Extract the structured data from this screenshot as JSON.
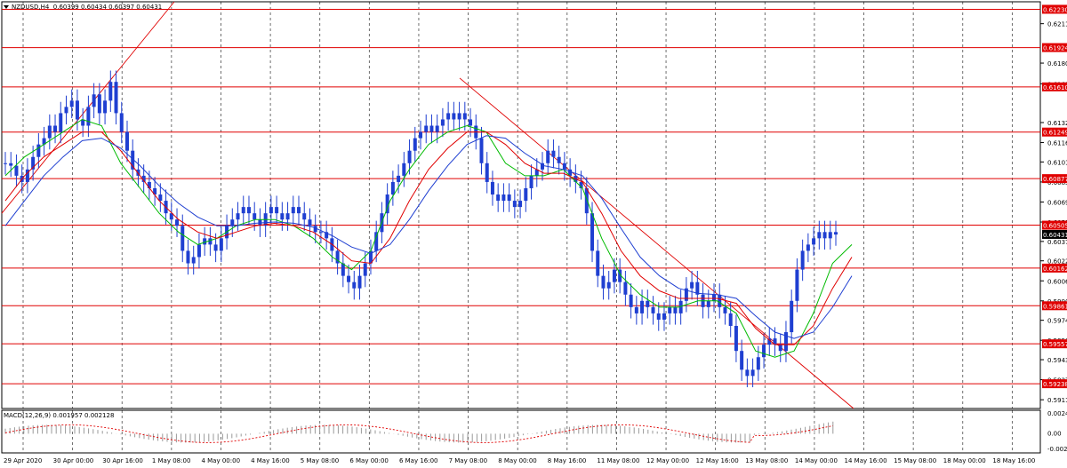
{
  "header": {
    "symbol": "NZDUSD,H4",
    "ohlc": "0.60399 0.60434 0.60397 0.60431"
  },
  "macd_header": {
    "label": "MACD(12,26,9) 0.001957 0.002128"
  },
  "colors": {
    "candles": "#1f3fd1",
    "levels": "#e00000",
    "ma_fast": "#00bb00",
    "ma_mid": "#e00000",
    "ma_slow": "#1f3fd1",
    "grid": "#000000",
    "background": "#ffffff"
  },
  "price_axis": {
    "ticks": [
      "0.62115",
      "0.61800",
      "0.61635",
      "0.61325",
      "0.61165",
      "0.61010",
      "0.60850",
      "0.60690",
      "0.60530",
      "0.60375",
      "0.60220",
      "0.60060",
      "0.59900",
      "0.59745",
      "0.59585",
      "0.59430",
      "0.59270",
      "0.59110"
    ],
    "current_price": "0.60431"
  },
  "levels": [
    "0.62230",
    "0.61924",
    "0.61610",
    "0.61249",
    "0.60877",
    "0.60505",
    "0.60162",
    "0.59861",
    "0.59557",
    "0.59238"
  ],
  "time_axis": [
    "29 Apr 2020",
    "30 Apr 00:00",
    "30 Apr 16:00",
    "1 May 08:00",
    "4 May 00:00",
    "4 May 16:00",
    "5 May 08:00",
    "6 May 00:00",
    "6 May 16:00",
    "7 May 08:00",
    "8 May 00:00",
    "8 May 16:00",
    "11 May 08:00",
    "12 May 00:00",
    "12 May 16:00",
    "13 May 08:00",
    "14 May 00:00",
    "14 May 16:00",
    "15 May 08:00",
    "18 May 00:00",
    "18 May 16:00"
  ],
  "macd_axis": [
    "0.002448",
    "0.00",
    "-0.00232"
  ],
  "chart_data": {
    "type": "line",
    "title": "NZDUSD,H4",
    "ylim": [
      0.5904,
      0.6229
    ],
    "grid": true,
    "series": [
      {
        "name": "NZDUSD,H4",
        "values": [
          0.61,
          0.6098,
          0.609,
          0.6085,
          0.6095,
          0.6105,
          0.6115,
          0.612,
          0.613,
          0.6125,
          0.614,
          0.6145,
          0.615,
          0.6135,
          0.613,
          0.6145,
          0.6155,
          0.614,
          0.615,
          0.6165,
          0.614,
          0.6125,
          0.611,
          0.6095,
          0.609,
          0.6085,
          0.608,
          0.6075,
          0.607,
          0.606,
          0.6055,
          0.605,
          0.603,
          0.602,
          0.6025,
          0.6035,
          0.604,
          0.6035,
          0.603,
          0.604,
          0.605,
          0.6055,
          0.606,
          0.6065,
          0.606,
          0.6055,
          0.605,
          0.606,
          0.6065,
          0.606,
          0.6055,
          0.606,
          0.6065,
          0.606,
          0.6055,
          0.605,
          0.6045,
          0.6045,
          0.604,
          0.603,
          0.602,
          0.601,
          0.6005,
          0.6,
          0.601,
          0.602,
          0.603,
          0.6045,
          0.606,
          0.6075,
          0.6085,
          0.609,
          0.61,
          0.611,
          0.612,
          0.6125,
          0.613,
          0.6125,
          0.613,
          0.6135,
          0.614,
          0.6135,
          0.614,
          0.6135,
          0.613,
          0.612,
          0.61,
          0.6085,
          0.6075,
          0.607,
          0.6075,
          0.607,
          0.6065,
          0.607,
          0.608,
          0.609,
          0.6095,
          0.61,
          0.611,
          0.6105,
          0.61,
          0.6095,
          0.609,
          0.6085,
          0.608,
          0.606,
          0.603,
          0.601,
          0.6,
          0.6005,
          0.6015,
          0.6005,
          0.5995,
          0.5985,
          0.598,
          0.599,
          0.5985,
          0.598,
          0.5975,
          0.598,
          0.5985,
          0.598,
          0.599,
          0.6,
          0.6005,
          0.5995,
          0.5985,
          0.599,
          0.5995,
          0.5985,
          0.598,
          0.597,
          0.595,
          0.5935,
          0.593,
          0.5935,
          0.5945,
          0.5955,
          0.596,
          0.5955,
          0.595,
          0.5965,
          0.599,
          0.6015,
          0.603,
          0.6035,
          0.604,
          0.6045,
          0.604,
          0.6045,
          0.6043
        ]
      },
      {
        "name": "MA fast",
        "values": [
          0.609,
          0.6105,
          0.6115,
          0.6125,
          0.6135,
          0.613,
          0.61,
          0.608,
          0.606,
          0.6045,
          0.6035,
          0.604,
          0.605,
          0.6055,
          0.6055,
          0.605,
          0.604,
          0.6025,
          0.6015,
          0.603,
          0.607,
          0.6095,
          0.6115,
          0.6125,
          0.613,
          0.6125,
          0.61,
          0.609,
          0.609,
          0.6095,
          0.608,
          0.604,
          0.601,
          0.5995,
          0.5985,
          0.5985,
          0.599,
          0.599,
          0.598,
          0.595,
          0.5945,
          0.595,
          0.598,
          0.602,
          0.6035
        ]
      },
      {
        "name": "MA mid",
        "values": [
          0.607,
          0.609,
          0.6105,
          0.6115,
          0.6125,
          0.6125,
          0.611,
          0.609,
          0.607,
          0.6055,
          0.6045,
          0.604,
          0.6045,
          0.605,
          0.6052,
          0.605,
          0.6045,
          0.6035,
          0.6022,
          0.602,
          0.604,
          0.607,
          0.6095,
          0.6112,
          0.6125,
          0.6125,
          0.6115,
          0.61,
          0.6092,
          0.6092,
          0.6085,
          0.606,
          0.603,
          0.601,
          0.5998,
          0.5992,
          0.5992,
          0.5992,
          0.5988,
          0.5968,
          0.5955,
          0.5955,
          0.597,
          0.6,
          0.6025
        ]
      },
      {
        "name": "MA slow",
        "values": [
          0.605,
          0.607,
          0.609,
          0.6105,
          0.6118,
          0.612,
          0.6112,
          0.6098,
          0.6082,
          0.6068,
          0.6057,
          0.605,
          0.605,
          0.6052,
          0.6053,
          0.6052,
          0.6049,
          0.6042,
          0.6033,
          0.6028,
          0.6035,
          0.6055,
          0.6078,
          0.6098,
          0.6115,
          0.6122,
          0.612,
          0.6108,
          0.6098,
          0.6095,
          0.609,
          0.6072,
          0.6048,
          0.6025,
          0.601,
          0.6,
          0.5996,
          0.5995,
          0.5992,
          0.5978,
          0.5965,
          0.596,
          0.5965,
          0.5985,
          0.601
        ]
      }
    ]
  }
}
